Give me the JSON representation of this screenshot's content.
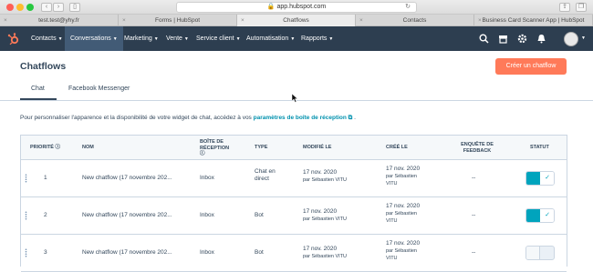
{
  "browser": {
    "url": "app.hubspot.com",
    "tabs": [
      {
        "label": "test.test@yhy.fr"
      },
      {
        "label": "Forms | HubSpot"
      },
      {
        "label": "Chatflows"
      },
      {
        "label": "Contacts"
      },
      {
        "label": "Business Card Scanner App | HubSpot"
      }
    ]
  },
  "nav": {
    "items": [
      {
        "label": "Contacts"
      },
      {
        "label": "Conversations"
      },
      {
        "label": "Marketing"
      },
      {
        "label": "Vente"
      },
      {
        "label": "Service client"
      },
      {
        "label": "Automatisation"
      },
      {
        "label": "Rapports"
      }
    ],
    "active_color": "#425b76",
    "bar_color": "#2d3e50"
  },
  "page": {
    "title": "Chatflows",
    "create_button": "Créer un chatflow",
    "tabs": [
      {
        "label": "Chat"
      },
      {
        "label": "Facebook Messenger"
      }
    ],
    "description": "Pour personnaliser l'apparence et la disponibilité de votre widget de chat, accédez à vos",
    "description_link": "paramètres de boîte de réception",
    "description_end": " ."
  },
  "table": {
    "headers": {
      "priority": "Priorité",
      "name": "Nom",
      "inbox_1": "Boîte de",
      "inbox_2": "réception",
      "type": "Type",
      "modified": "Modifié le",
      "created": "Créé le",
      "survey_1": "Enquête de",
      "survey_2": "feedback",
      "status": "Statut"
    },
    "rows": [
      {
        "priority": "1",
        "name": "New chatflow (17 novembre 202...",
        "inbox": "Inbox",
        "type_1": "Chat en",
        "type_2": "direct",
        "modified": "17 nov. 2020",
        "modified_by": "par Sébastien VITU",
        "created": "17 nov. 2020",
        "created_by": "par Sébastien",
        "created_by_2": "VITU",
        "survey": "--",
        "status": "on"
      },
      {
        "priority": "2",
        "name": "New chatflow (17 novembre 202...",
        "inbox": "Inbox",
        "type_1": "Bot",
        "type_2": "",
        "modified": "17 nov. 2020",
        "modified_by": "par Sébastien VITU",
        "created": "17 nov. 2020",
        "created_by": "par Sébastien",
        "created_by_2": "VITU",
        "survey": "--",
        "status": "on"
      },
      {
        "priority": "3",
        "name": "New chatflow (17 novembre 202...",
        "inbox": "Inbox",
        "type_1": "Bot",
        "type_2": "",
        "modified": "17 nov. 2020",
        "modified_by": "par Sébastien VITU",
        "created": "17 nov. 2020",
        "created_by": "par Sébastien",
        "created_by_2": "VITU",
        "survey": "--",
        "status": "off"
      }
    ]
  },
  "colors": {
    "accent": "#ff7a59",
    "toggle_on": "#00a4bd",
    "link": "#0091ae"
  }
}
